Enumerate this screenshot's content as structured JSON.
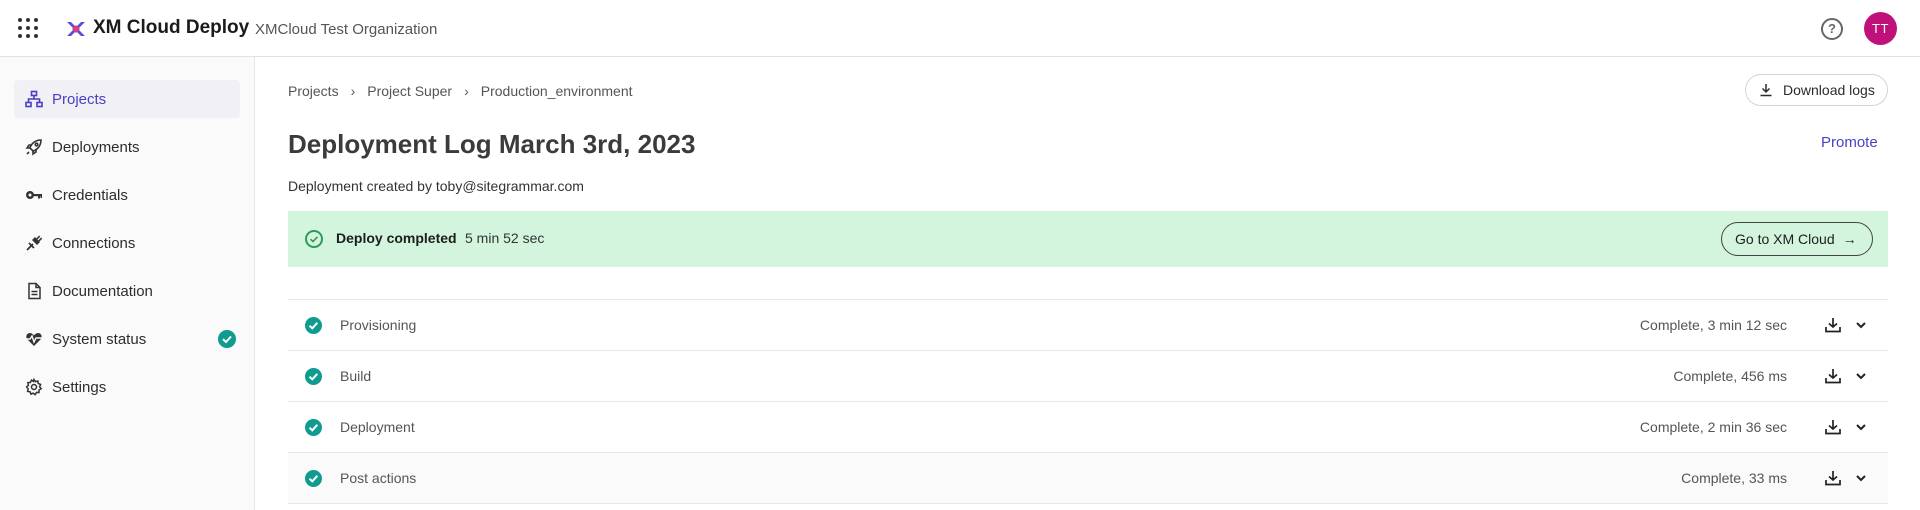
{
  "header": {
    "app_title": "XM Cloud Deploy",
    "org_name": "XMCloud Test Organization",
    "help_icon": "help-circle-icon",
    "avatar_initials": "TT",
    "avatar_color": "#c0117a"
  },
  "sidebar": {
    "items": [
      {
        "label": "Projects",
        "icon": "sitemap-icon",
        "active": true
      },
      {
        "label": "Deployments",
        "icon": "rocket-icon",
        "active": false
      },
      {
        "label": "Credentials",
        "icon": "key-icon",
        "active": false
      },
      {
        "label": "Connections",
        "icon": "plug-icon",
        "active": false
      },
      {
        "label": "Documentation",
        "icon": "document-icon",
        "active": false
      },
      {
        "label": "System status",
        "icon": "heartbeat-icon",
        "active": false,
        "status": "operational"
      },
      {
        "label": "Settings",
        "icon": "gear-icon",
        "active": false
      }
    ]
  },
  "breadcrumb": [
    "Projects",
    "Project Super",
    "Production_environment"
  ],
  "actions": {
    "download_logs": "Download logs",
    "promote": "Promote"
  },
  "page": {
    "title": "Deployment Log March 3rd, 2023",
    "created_by": "Deployment created by toby@sitegrammar.com"
  },
  "banner": {
    "status": "Deploy completed",
    "duration": "5 min 52 sec",
    "button": "Go to XM Cloud",
    "color": "#d3f5dd"
  },
  "steps": [
    {
      "name": "Provisioning",
      "status": "Complete, 3 min 12 sec"
    },
    {
      "name": "Build",
      "status": "Complete, 456 ms"
    },
    {
      "name": "Deployment",
      "status": "Complete, 2 min 36 sec"
    },
    {
      "name": "Post actions",
      "status": "Complete, 33 ms"
    }
  ],
  "colors": {
    "accent": "#4a3fc4",
    "success": "#0f9b8e"
  }
}
